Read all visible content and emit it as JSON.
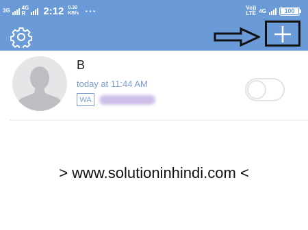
{
  "status_bar": {
    "net1": "3G",
    "net2": "4G",
    "net2_sub": "R",
    "time": "2:12",
    "speed_value": "0.30",
    "speed_unit": "KB/s",
    "overflow": "···",
    "volte_top": "Vo))",
    "volte_bottom": "LTE",
    "net_right": "4G",
    "battery_level": "100"
  },
  "icons": {
    "settings": "gear-icon",
    "arrow": "arrow-right-icon",
    "add": "plus-icon",
    "avatar": "person-silhouette-icon"
  },
  "contact": {
    "name": "B",
    "time": "today at 11:44 AM",
    "badge": "WA",
    "enabled": false
  },
  "watermark": "> www.solutioninhindi.com <",
  "colors": {
    "header": "#6a9bd8",
    "accent_text": "#7a9bd0",
    "avatar_bg": "#e6e6e8",
    "avatar_fg": "#bdbdc2",
    "blurred_number": "#cdbde9"
  }
}
